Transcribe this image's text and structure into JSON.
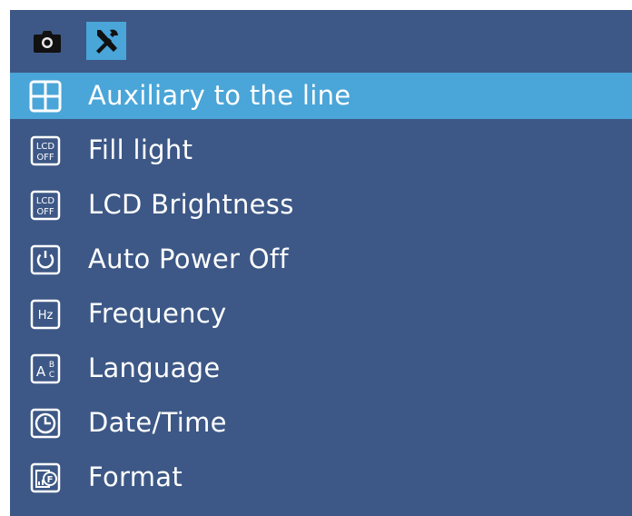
{
  "tabs": [
    {
      "name": "camera",
      "icon": "camera-icon",
      "selected": false
    },
    {
      "name": "settings",
      "icon": "tools-icon",
      "selected": true
    }
  ],
  "menu": {
    "items": [
      {
        "label": "Auxiliary to the line",
        "icon": "grid-icon",
        "selected": true
      },
      {
        "label": "Fill light",
        "icon": "lcd-off-icon",
        "icon_text": [
          "LCD",
          "OFF"
        ]
      },
      {
        "label": "LCD Brightness",
        "icon": "lcd-off-icon",
        "icon_text": [
          "LCD",
          "OFF"
        ]
      },
      {
        "label": "Auto Power Off",
        "icon": "power-icon"
      },
      {
        "label": "Frequency",
        "icon": "hz-icon",
        "icon_text": [
          "Hz"
        ]
      },
      {
        "label": "Language",
        "icon": "language-icon",
        "icon_text": [
          "A",
          "B",
          "C"
        ]
      },
      {
        "label": "Date/Time",
        "icon": "clock-icon"
      },
      {
        "label": "Format",
        "icon": "format-icon",
        "icon_text": [
          "F"
        ]
      }
    ]
  },
  "colors": {
    "background": "#3d5886",
    "highlight": "#4aa5d8",
    "text": "#ffffff"
  }
}
